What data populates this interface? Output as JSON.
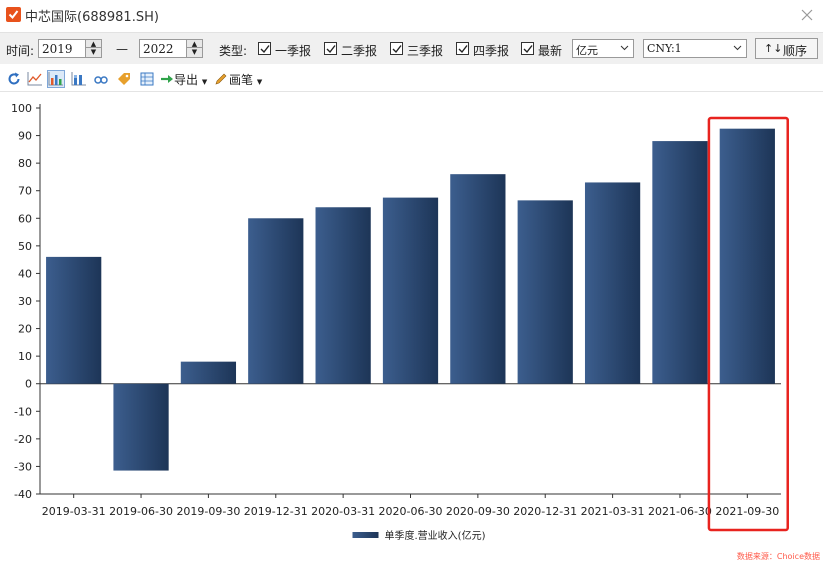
{
  "window": {
    "title": "中芯国际(688981.SH)"
  },
  "toolbar": {
    "time_label": "时间:",
    "start_year": "2019",
    "dash": "—",
    "end_year": "2022",
    "type_label": "类型:",
    "checkboxes": [
      {
        "label": "一季报",
        "checked": true
      },
      {
        "label": "二季报",
        "checked": true
      },
      {
        "label": "三季报",
        "checked": true
      },
      {
        "label": "四季报",
        "checked": true
      },
      {
        "label": "最新",
        "checked": true
      }
    ],
    "unit_select": "亿元",
    "currency_select": "CNY:1",
    "order_button": "顺序",
    "order_icon": "↑↓"
  },
  "toolbar2": {
    "icons": [
      "refresh-icon",
      "line-chart-icon",
      "bar-chart-icon",
      "stacked-bar-icon",
      "link-icon",
      "tag-icon",
      "table-icon",
      "export-icon",
      "pen-icon"
    ],
    "export_label": "导出",
    "pen_label": "画笔"
  },
  "chart_data": {
    "type": "bar",
    "categories": [
      "2019-03-31",
      "2019-06-30",
      "2019-09-30",
      "2019-12-31",
      "2020-03-31",
      "2020-06-30",
      "2020-09-30",
      "2020-12-31",
      "2021-03-31",
      "2021-06-30",
      "2021-09-30"
    ],
    "series": [
      {
        "name": "单季度.营业收入(亿元)",
        "values": [
          46,
          -31.5,
          8,
          60,
          64,
          67.5,
          76,
          66.5,
          73,
          88,
          92.5
        ]
      }
    ],
    "yticks": [
      100,
      90,
      80,
      70,
      60,
      50,
      40,
      30,
      20,
      10,
      0,
      -10,
      -20,
      -30,
      -40
    ],
    "ylim": [
      -40,
      100
    ],
    "grid": false,
    "legend_position": "bottom-center",
    "highlighted_category": "2021-09-30",
    "colors": {
      "bar_dark": "#1d3557",
      "bar_light": "#3c5e8e",
      "highlight": "#e8231f"
    }
  },
  "source_note": "数据来源：Choice数据"
}
